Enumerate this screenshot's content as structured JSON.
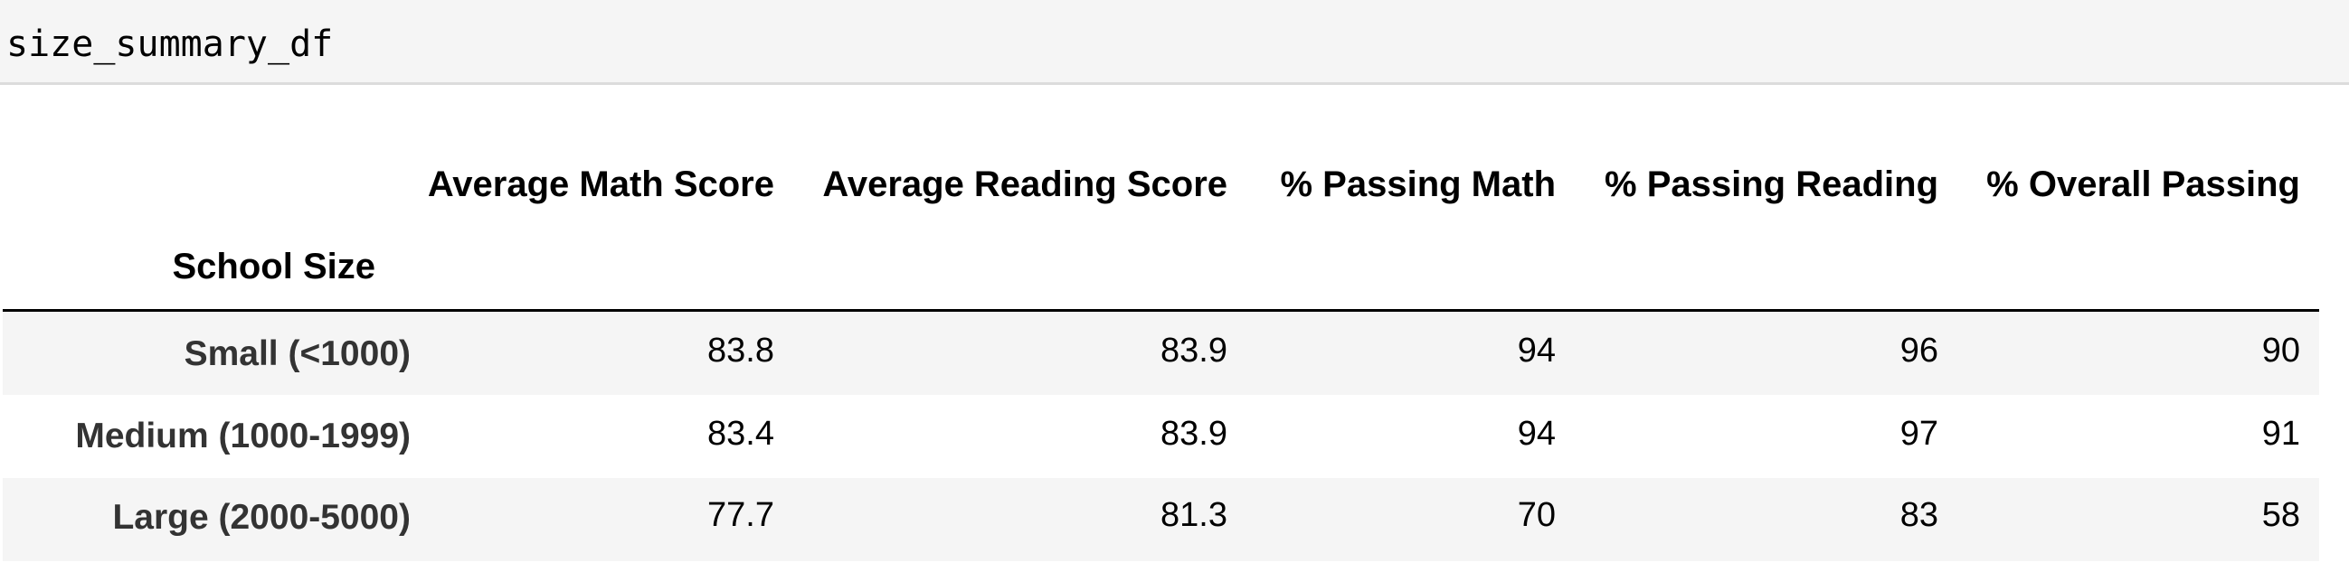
{
  "code_cell": {
    "source": "size_summary_df"
  },
  "table": {
    "columns": [
      "Average Math Score",
      "Average Reading Score",
      "% Passing Math",
      "% Passing Reading",
      "% Overall Passing"
    ],
    "index_name": "School Size",
    "rows": [
      {
        "label": "Small (<1000)",
        "values": [
          "83.8",
          "83.9",
          "94",
          "96",
          "90"
        ]
      },
      {
        "label": "Medium (1000-1999)",
        "values": [
          "83.4",
          "83.9",
          "94",
          "97",
          "91"
        ]
      },
      {
        "label": "Large (2000-5000)",
        "values": [
          "77.7",
          "81.3",
          "70",
          "83",
          "58"
        ]
      }
    ]
  }
}
